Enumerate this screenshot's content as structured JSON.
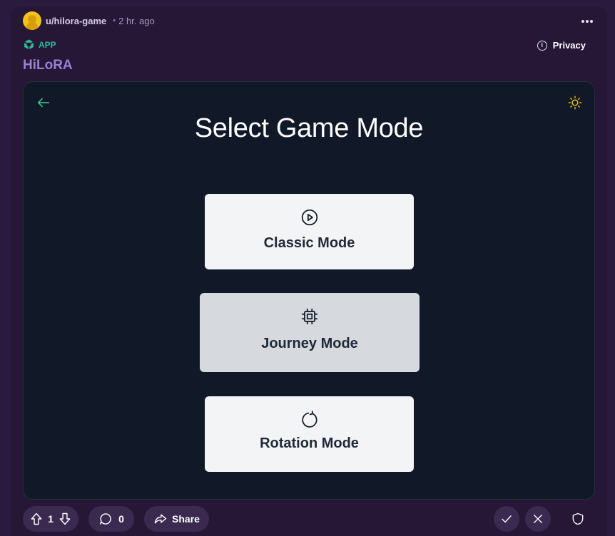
{
  "post": {
    "username": "u/hilora-game",
    "separator": "•",
    "time": "2 hr. ago",
    "app_label": "APP",
    "privacy_label": "Privacy",
    "title": "HiLoRA"
  },
  "game": {
    "heading": "Select Game Mode",
    "modes": [
      {
        "label": "Classic Mode",
        "icon": "play-circle-icon"
      },
      {
        "label": "Journey Mode",
        "icon": "cpu-chip-icon"
      },
      {
        "label": "Rotation Mode",
        "icon": "rotate-icon"
      }
    ],
    "accent_color": "#34d399",
    "theme_icon_color": "#facc15"
  },
  "footer": {
    "vote_count": "1",
    "comment_count": "0",
    "share_label": "Share"
  },
  "colors": {
    "page_bg": "#2a1a3e",
    "frame_bg": "#111827",
    "button_bg": "#f3f4f6",
    "button_selected_bg": "#d6d9de",
    "title_color": "#9b7fd6",
    "app_color": "#2fb89a"
  }
}
